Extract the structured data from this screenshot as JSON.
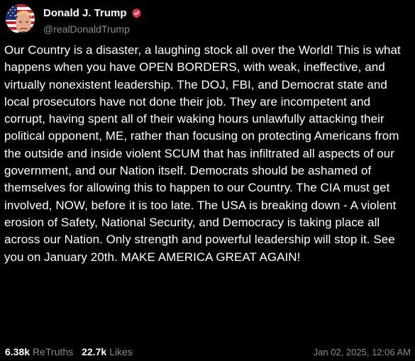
{
  "post": {
    "author": {
      "display_name": "Donald J. Trump",
      "handle": "@realDonaldTrump",
      "verified_icon": "verified-badge-icon",
      "verified_color": "#e6364c"
    },
    "body": "Our Country is a disaster, a laughing stock all over the World! This is what happens when you have OPEN BORDERS, with weak, ineffective, and virtually nonexistent leadership. The DOJ, FBI, and Democrat state and local prosecutors have not done their job. They are incompetent and corrupt, having spent all of their waking hours unlawfully attacking their political opponent, ME, rather than focusing on protecting Americans from the outside and inside violent SCUM that has infiltrated all aspects of our government, and our Nation itself. Democrats should be ashamed of themselves for allowing this to happen to our Country. The CIA must get involved, NOW, before it is too late. The USA is breaking down - A violent erosion of Safety, National Security, and Democracy is taking place all across our Nation. Only strength and powerful leadership will stop it. See you on January 20th. MAKE AMERICA GREAT AGAIN!",
    "stats": {
      "retruths_count": "6.38k",
      "retruths_label": "ReTruths",
      "likes_count": "22.7k",
      "likes_label": "Likes"
    },
    "timestamp": "Jan 02, 2025, 12:06 AM"
  },
  "colors": {
    "background": "#000000",
    "text_primary": "#ffffff",
    "text_secondary": "#8b8b92",
    "verified_badge": "#e6364c"
  }
}
